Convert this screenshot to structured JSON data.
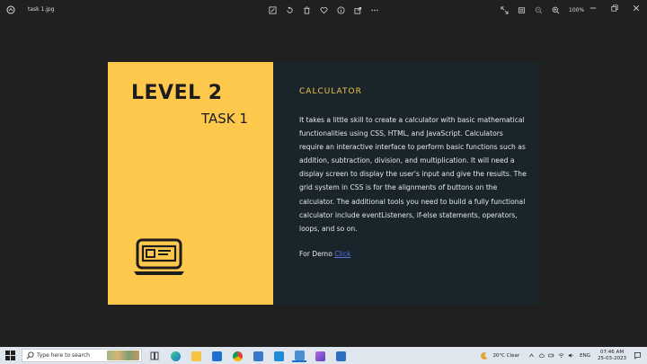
{
  "window": {
    "file_name": "task 1.jpg",
    "zoom": "100%"
  },
  "image": {
    "level": "LEVEL 2",
    "task": "TASK 1",
    "heading": "CALCULATOR",
    "description": "It takes a little skill to create a calculator with basic mathematical functionalities using CSS, HTML, and JavaScript. Calculators require an interactive interface to perform basic functions such as addition, subtraction, division, and multiplication. It will need a  display screen to display the user's input and give the results. The grid system in CSS is for the alignments of buttons on the calculator. The additional tools you need to build a fully functional calculator include eventListeners, if-else statements, operators, loops, and so on.",
    "demo_prefix": "For Demo ",
    "demo_link": "Click"
  },
  "taskbar": {
    "search_placeholder": "Type here to search",
    "weather": "20°C  Clear",
    "language": "ENG",
    "time": "07:46 AM",
    "date": "25-03-2023"
  },
  "colors": {
    "yellow": "#fec84c",
    "dark": "#1a252b",
    "accent": "#f3c448",
    "link": "#5a6fe0"
  }
}
